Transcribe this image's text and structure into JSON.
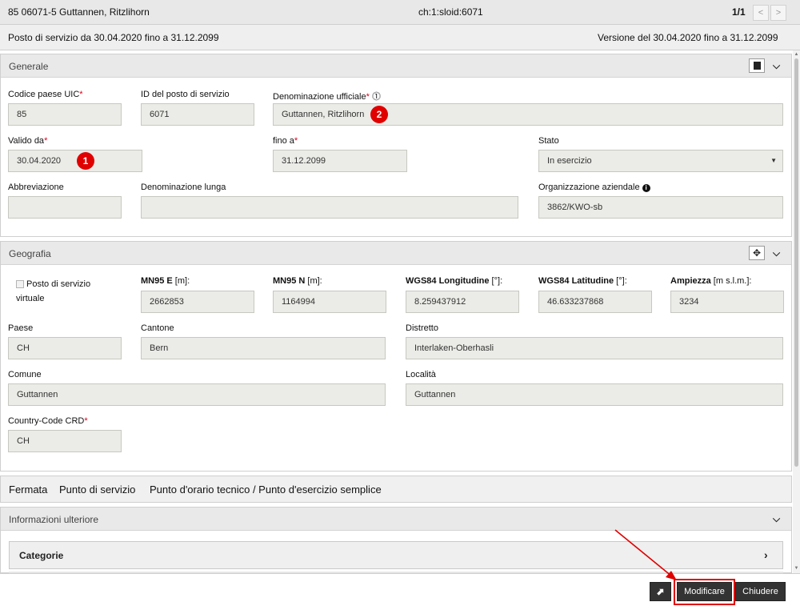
{
  "header": {
    "title": "85 06071-5 Guttannen, Ritzlihorn",
    "sloid": "ch:1:sloid:6071",
    "pager": "1/1",
    "prev_icon": "chevron-left-icon",
    "next_icon": "chevron-right-icon"
  },
  "subheader": {
    "validity": "Posto di servizio da 30.04.2020 fino a 31.12.2099",
    "version": "Versione del 30.04.2020 fino a 31.12.2099"
  },
  "generale": {
    "title": "Generale",
    "fields": {
      "uic": {
        "label": "Codice paese UIC",
        "required": "*",
        "value": "85"
      },
      "id": {
        "label": "ID del posto di servizio",
        "value": "6071"
      },
      "denominazione": {
        "label": "Denominazione ufficiale",
        "required": "*",
        "info_glyph": "⓵",
        "value": "Guttannen, Ritzlihorn"
      },
      "valido_da": {
        "label": "Valido da",
        "required": "*",
        "value": "30.04.2020"
      },
      "fino_a": {
        "label": "fino a",
        "required": "*",
        "value": "31.12.2099"
      },
      "stato": {
        "label": "Stato",
        "value": "In esercizio"
      },
      "abbreviazione": {
        "label": "Abbreviazione",
        "value": ""
      },
      "denominazione_lunga": {
        "label": "Denominazione lunga",
        "value": ""
      },
      "organizzazione": {
        "label": "Organizzazione aziendale",
        "value": "3862/KWO-sb"
      }
    },
    "badges": {
      "one": "1",
      "two": "2"
    }
  },
  "geografia": {
    "title": "Geografia",
    "virtual_label_1": "Posto di servizio",
    "virtual_label_2": "virtuale",
    "fields": {
      "mn95_e": {
        "label_bold": "MN95 E",
        "label_rest": " [m]:",
        "value": "2662853"
      },
      "mn95_n": {
        "label_bold": "MN95 N",
        "label_rest": " [m]:",
        "value": "1164994"
      },
      "wgs_lon": {
        "label_bold": "WGS84 Longitudine",
        "label_rest": " [°]:",
        "value": "8.259437912"
      },
      "wgs_lat": {
        "label_bold": "WGS84 Latitudine",
        "label_rest": " [°]:",
        "value": "46.633237868"
      },
      "ampiezza": {
        "label_bold": "Ampiezza",
        "label_rest": " [m s.l.m.]:",
        "value": "3234"
      },
      "paese": {
        "label": "Paese",
        "value": "CH"
      },
      "cantone": {
        "label": "Cantone",
        "value": "Bern"
      },
      "distretto": {
        "label": "Distretto",
        "value": "Interlaken-Oberhasli"
      },
      "comune": {
        "label": "Comune",
        "value": "Guttannen"
      },
      "localita": {
        "label": "Località",
        "value": "Guttannen"
      },
      "country_code": {
        "label": "Country-Code CRD",
        "required": "*",
        "value": "CH"
      }
    }
  },
  "types_bar": {
    "items": [
      "Fermata",
      "Punto di servizio",
      "Punto d'orario tecnico / Punto d'esercizio semplice"
    ]
  },
  "informazioni": {
    "title": "Informazioni ulteriore",
    "categorie": "Categorie"
  },
  "footer": {
    "modify": "Modificare",
    "close": "Chiudere"
  },
  "colors": {
    "required": "#d9001b",
    "badge": "#e00000",
    "annotation": "#e00000",
    "button": "#333333"
  }
}
